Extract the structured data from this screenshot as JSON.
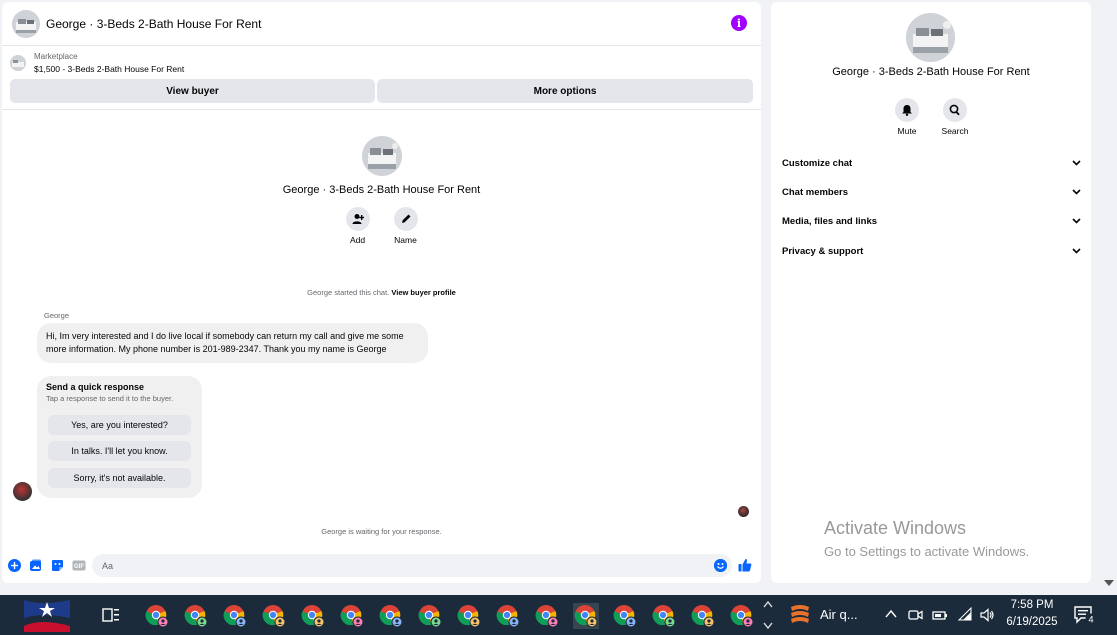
{
  "chat": {
    "title": "George · 3-Beds 2-Bath House For Rent",
    "info_icon": "i"
  },
  "marketplace": {
    "label": "Marketplace",
    "listing": "$1,500 - 3-Beds 2-Bath House For Rent",
    "view_buyer": "View buyer",
    "more_options": "More options"
  },
  "conversation": {
    "name": "George · 3-Beds 2-Bath House For Rent",
    "add_label": "Add",
    "name_label": "Name",
    "started_text": "George started this chat.",
    "view_profile": "View buyer profile",
    "sender": "George",
    "message": "Hi, Im very interested and I do live local if somebody can return my call and give me some more information. My phone number is 201-989-2347. Thank you my name is George",
    "quick_title": "Send a quick response",
    "quick_sub": "Tap a response to send it to the buyer.",
    "quick_responses": [
      "Yes, are you interested?",
      "In talks. I'll let you know.",
      "Sorry, it's not available."
    ],
    "waiting": "George is waiting for your response."
  },
  "composer": {
    "placeholder": "Aa",
    "icons": [
      "plus-circle-icon",
      "photo-icon",
      "sticker-icon",
      "gif-icon",
      "emoji-icon",
      "like-icon"
    ]
  },
  "info_panel": {
    "title": "George · 3-Beds 2-Bath House For Rent",
    "mute": "Mute",
    "search": "Search",
    "menu": [
      "Customize chat",
      "Chat members",
      "Media, files and links",
      "Privacy & support"
    ]
  },
  "watermark": {
    "line1": "Activate Windows",
    "line2": "Go to Settings to activate Windows."
  },
  "taskbar": {
    "weather": "Air q...",
    "time": "7:58 PM",
    "date": "6/19/2025",
    "notifications": "4"
  },
  "colors": {
    "accent": "#0866ff",
    "info": "#a100ff",
    "taskbar": "#1c2b3b"
  }
}
